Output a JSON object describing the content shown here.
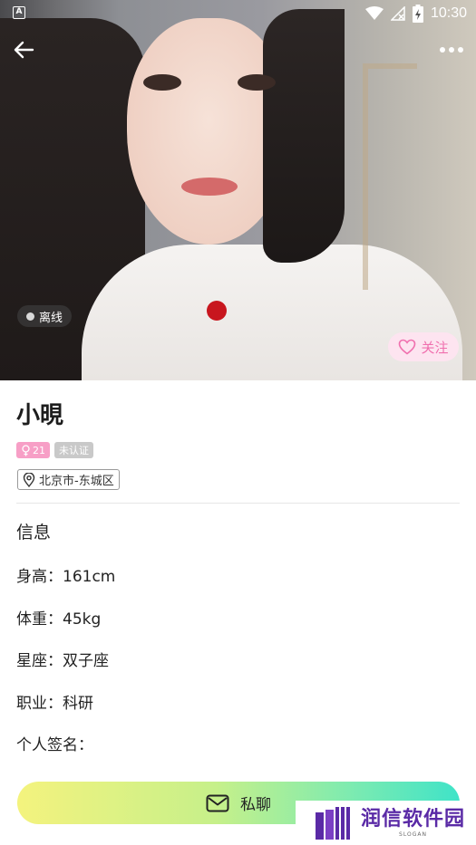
{
  "status_bar": {
    "app_icon_letter": "A",
    "time": "10:30"
  },
  "profile": {
    "status": "离线",
    "follow_label": "关注",
    "name": "小晛",
    "age": "21",
    "verify_label": "未认证",
    "location": "北京市-东城区"
  },
  "info": {
    "section_title": "信息",
    "rows": [
      "身高：161cm",
      "体重：45kg",
      "星座：双子座",
      "职业：科研",
      "个人签名："
    ]
  },
  "bottom": {
    "chat_label": "私聊"
  },
  "watermark": {
    "main": "润信软件园",
    "sub": "SLOGAN"
  },
  "colors": {
    "follow_bg": "#fde4f0",
    "follow_text": "#f06fae",
    "gender_tag": "#f79fc6",
    "verify_tag": "#c9c9c9",
    "chat_gradient_start": "#f4f37e",
    "chat_gradient_end": "#3fe3c8",
    "watermark_purple": "#5a2aa6"
  },
  "icons": [
    "back-arrow-icon",
    "more-icon",
    "wifi-icon",
    "signal-icon",
    "battery-icon",
    "heart-icon",
    "female-icon",
    "location-pin-icon",
    "mail-icon"
  ]
}
